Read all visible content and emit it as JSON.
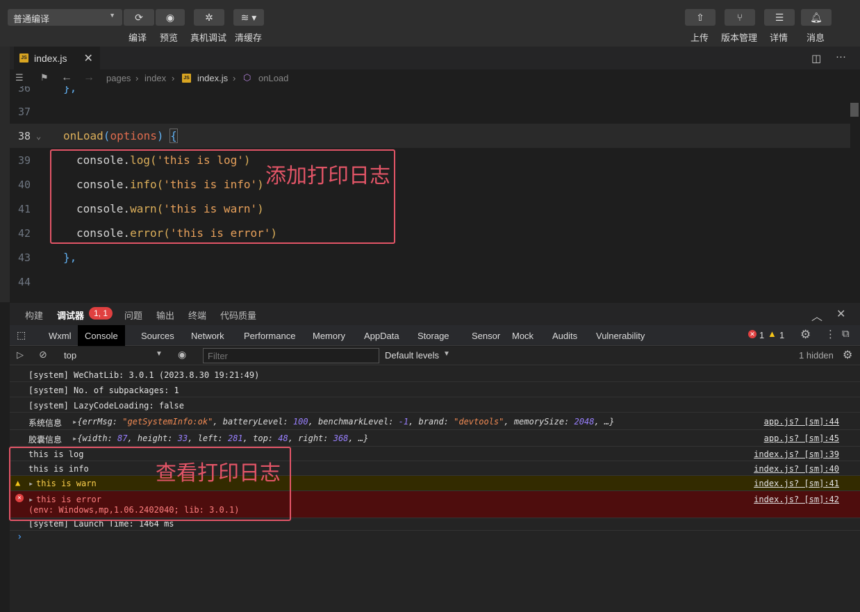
{
  "toolbar": {
    "mode": "普通编译",
    "compile_label": "编译",
    "preview_label": "预览",
    "realdevice_label": "真机调试",
    "clearcache_label": "清缓存",
    "upload_label": "上传",
    "version_label": "版本管理",
    "details_label": "详情",
    "messages_label": "消息"
  },
  "tab": {
    "filename": "index.js",
    "js_badge": "JS"
  },
  "breadcrumb": {
    "p1": "pages",
    "p2": "index",
    "p3": "index.js",
    "p4": "onLoad"
  },
  "code": {
    "l36_num": "36",
    "l36": "},",
    "l37_num": "37",
    "l38_num": "38",
    "l38_fn": "onLoad",
    "l38_p1": "(",
    "l38_param": "options",
    "l38_p2": ") ",
    "l38_brace": "{",
    "l39_num": "39",
    "l39_a": "console.",
    "l39_fn": "log",
    "l39_b": "(",
    "l39_s": "'this is log'",
    "l39_c": ")",
    "l40_num": "40",
    "l40_a": "console.",
    "l40_fn": "info",
    "l40_b": "(",
    "l40_s": "'this is info'",
    "l40_c": ")",
    "l41_num": "41",
    "l41_a": "console.",
    "l41_fn": "warn",
    "l41_b": "(",
    "l41_s": "'this is warn'",
    "l41_c": ")",
    "l42_num": "42",
    "l42_a": "console.",
    "l42_fn": "error",
    "l42_b": "(",
    "l42_s": "'this is error'",
    "l42_c": ")",
    "l43_num": "43",
    "l43": "},",
    "l44_num": "44"
  },
  "annotations": {
    "code_note": "添加打印日志",
    "console_note": "查看打印日志"
  },
  "panel_tabs": {
    "build": "构建",
    "debugger": "调试器",
    "badge": "1, 1",
    "issues": "问题",
    "output": "输出",
    "terminal": "终端",
    "quality": "代码质量"
  },
  "devtools_tabs": [
    "Wxml",
    "Console",
    "Sources",
    "Network",
    "Performance",
    "Memory",
    "AppData",
    "Storage",
    "Sensor",
    "Mock",
    "Audits",
    "Vulnerability"
  ],
  "devtools_counts": {
    "errors": "1",
    "warnings": "1"
  },
  "filter": {
    "context": "top",
    "placeholder": "Filter",
    "levels": "Default levels",
    "hidden": "1 hidden"
  },
  "console": {
    "r1": "[system] WeChatLib: 3.0.1 (2023.8.30 19:21:49)",
    "r2": "[system] No. of subpackages: 1",
    "r3": "[system] LazyCodeLoading: false",
    "r4_label": "系统信息",
    "r4_src": "app.js? [sm]:44",
    "r5_label": "胶囊信息",
    "r5_src": "app.js? [sm]:45",
    "r6": "this is log",
    "r6_src": "index.js? [sm]:39",
    "r7": "this is info",
    "r7_src": "index.js? [sm]:40",
    "r8": "this is warn",
    "r8_src": "index.js? [sm]:41",
    "r9": "this is error",
    "r9_env": "(env: Windows,mp,1.06.2402040; lib: 3.0.1)",
    "r9_src": "index.js? [sm]:42",
    "r10": "[system] Launch Time: 1464 ms",
    "prompt": "›"
  },
  "colors": {
    "annotation": "#e35567",
    "warn_bg": "#332b00",
    "error_bg": "#4e0d0d",
    "accent": "#d9a521"
  }
}
